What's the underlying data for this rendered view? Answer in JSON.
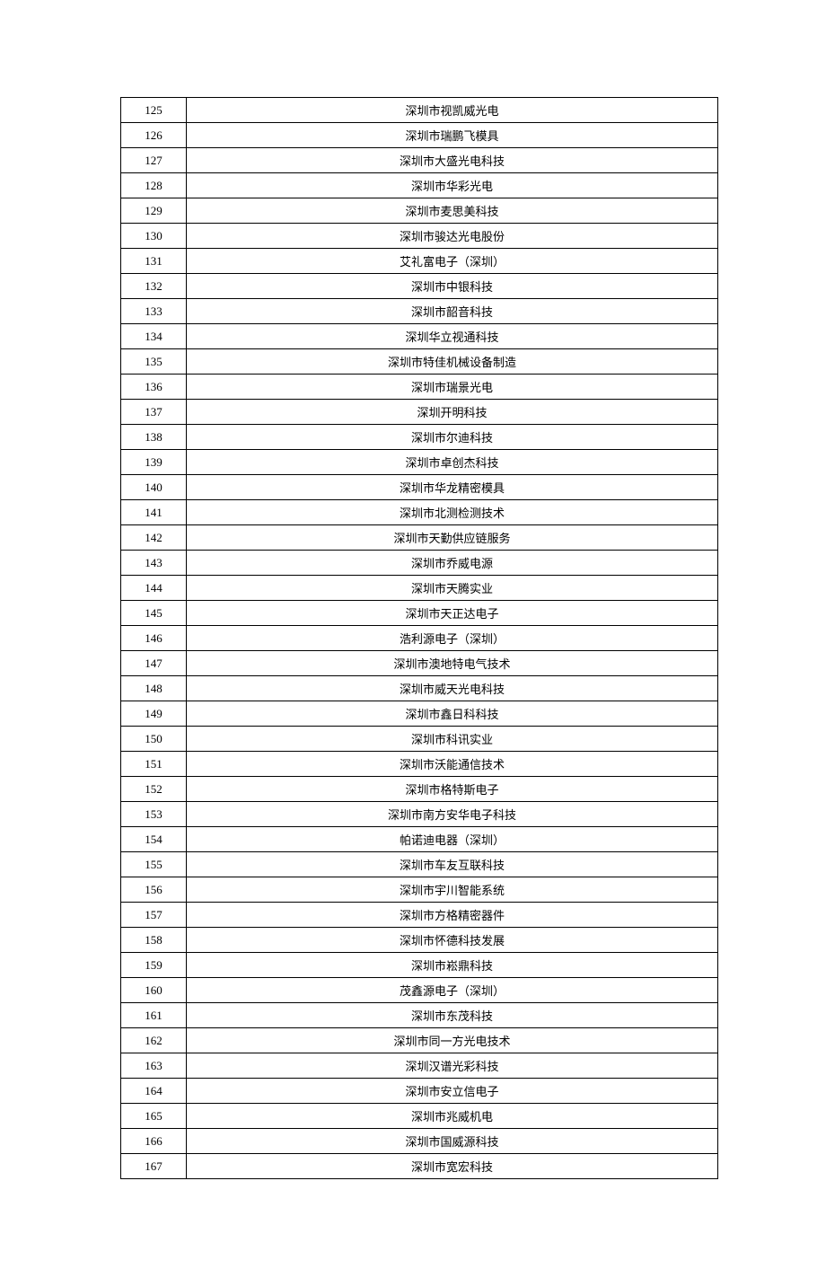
{
  "rows": [
    {
      "num": "125",
      "name": "深圳市视凯威光电"
    },
    {
      "num": "126",
      "name": "深圳市瑞鹏飞模具"
    },
    {
      "num": "127",
      "name": "深圳市大盛光电科技"
    },
    {
      "num": "128",
      "name": "深圳市华彩光电"
    },
    {
      "num": "129",
      "name": "深圳市麦思美科技"
    },
    {
      "num": "130",
      "name": "深圳市骏达光电股份"
    },
    {
      "num": "131",
      "name": "艾礼富电子（深圳）"
    },
    {
      "num": "132",
      "name": "深圳市中银科技"
    },
    {
      "num": "133",
      "name": "深圳市韶音科技"
    },
    {
      "num": "134",
      "name": "深圳华立视通科技"
    },
    {
      "num": "135",
      "name": "深圳市特佳机械设备制造"
    },
    {
      "num": "136",
      "name": "深圳市瑞景光电"
    },
    {
      "num": "137",
      "name": "深圳开明科技"
    },
    {
      "num": "138",
      "name": "深圳市尔迪科技"
    },
    {
      "num": "139",
      "name": "深圳市卓创杰科技"
    },
    {
      "num": "140",
      "name": "深圳市华龙精密模具"
    },
    {
      "num": "141",
      "name": "深圳市北测检测技术"
    },
    {
      "num": "142",
      "name": "深圳市天勤供应链服务"
    },
    {
      "num": "143",
      "name": "深圳市乔威电源"
    },
    {
      "num": "144",
      "name": "深圳市天腾实业"
    },
    {
      "num": "145",
      "name": "深圳市天正达电子"
    },
    {
      "num": "146",
      "name": "浩利源电子（深圳）"
    },
    {
      "num": "147",
      "name": "深圳市澳地特电气技术"
    },
    {
      "num": "148",
      "name": "深圳市威天光电科技"
    },
    {
      "num": "149",
      "name": "深圳市鑫日科科技"
    },
    {
      "num": "150",
      "name": "深圳市科讯实业"
    },
    {
      "num": "151",
      "name": "深圳市沃能通信技术"
    },
    {
      "num": "152",
      "name": "深圳市格特斯电子"
    },
    {
      "num": "153",
      "name": "深圳市南方安华电子科技"
    },
    {
      "num": "154",
      "name": "帕诺迪电器（深圳）"
    },
    {
      "num": "155",
      "name": "深圳市车友互联科技"
    },
    {
      "num": "156",
      "name": "深圳市宇川智能系统"
    },
    {
      "num": "157",
      "name": "深圳市方格精密器件"
    },
    {
      "num": "158",
      "name": "深圳市怀德科技发展"
    },
    {
      "num": "159",
      "name": "深圳市崧鼎科技"
    },
    {
      "num": "160",
      "name": "茂鑫源电子（深圳）"
    },
    {
      "num": "161",
      "name": "深圳市东茂科技"
    },
    {
      "num": "162",
      "name": "深圳市同一方光电技术"
    },
    {
      "num": "163",
      "name": "深圳汉谱光彩科技"
    },
    {
      "num": "164",
      "name": "深圳市安立信电子"
    },
    {
      "num": "165",
      "name": "深圳市兆威机电"
    },
    {
      "num": "166",
      "name": "深圳市国威源科技"
    },
    {
      "num": "167",
      "name": "深圳市宽宏科技"
    }
  ]
}
